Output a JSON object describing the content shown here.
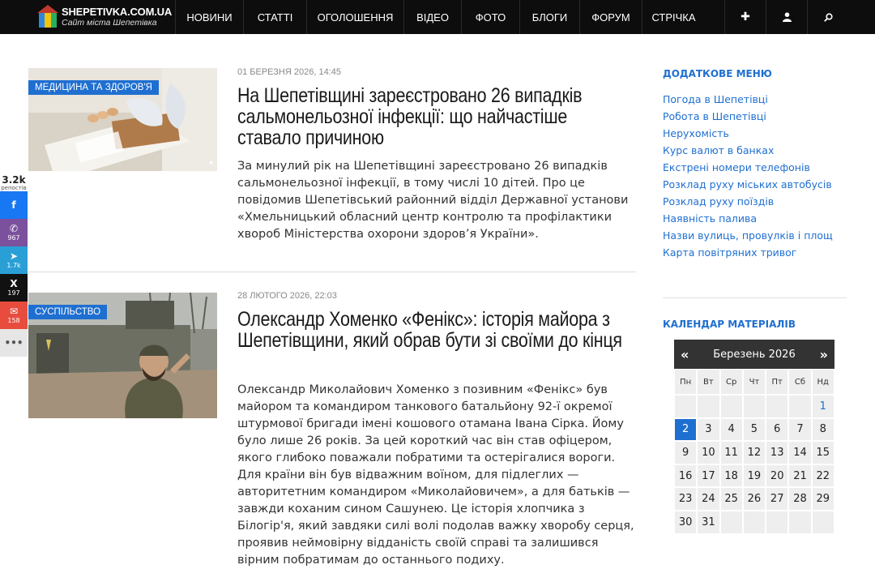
{
  "site": {
    "title": "SHEPETIVKA.COM.UA",
    "subtitle": "Сайт міста Шепетівка"
  },
  "nav": {
    "items": [
      "НОВИНИ",
      "СТАТТІ",
      "ОГОЛОШЕННЯ",
      "ВІДЕО",
      "ФОТО",
      "БЛОГИ",
      "ФОРУМ",
      "СТРІЧКА"
    ],
    "icons": [
      "plus-icon",
      "user-icon",
      "search-icon"
    ]
  },
  "share": {
    "total": "3.2k",
    "total_label": "репостів",
    "buttons": [
      {
        "name": "facebook",
        "icon": "f",
        "count": "",
        "color": "#1877f2"
      },
      {
        "name": "viber",
        "icon": "✆",
        "count": "967",
        "color": "#7b519d"
      },
      {
        "name": "telegram",
        "icon": "➤",
        "count": "1.7k",
        "color": "#2a9fd6"
      },
      {
        "name": "x",
        "icon": "X",
        "count": "197",
        "color": "#111111"
      },
      {
        "name": "email",
        "icon": "✉",
        "count": "158",
        "color": "#e74c3c"
      },
      {
        "name": "more",
        "icon": "•••",
        "count": "",
        "color": "#e6e6e6"
      }
    ]
  },
  "articles": [
    {
      "category": "МЕДИЦИНА ТА ЗДОРОВ'Я",
      "date": "01 БЕРЕЗНЯ 2026, 14:45",
      "title": "На Шепетівщині зареєстровано 26 випадків сальмонельозної інфекції: що найчастіше ставало причиною",
      "excerpt": "За минулий рік на Шепетівщині зареєстровано 26 випадків сальмонельозної інфекції, в тому числі 10 дітей. Про це повідомив Шепетівський районний відділ Державної установи «Хмельницький обласний центр контролю та профілактики хвороб Міністерства охорони здоров’я України»."
    },
    {
      "category": "СУСПІЛЬСТВО",
      "date": "28 ЛЮТОГО 2026, 22:03",
      "title": "Олександр Хоменко «Фенікс»: історія майора з Шепетівщини, який обрав бути зі своїми до кінця",
      "excerpt": "Олександр Миколайович Хоменко з позивним «Фенікс» був майором та командиром танкового батальйону 92-ї окремої штурмової бригади імені кошового отамана Івана Сірка. Йому було лише 26 років. За цей короткий час він став офіцером, якого глибоко поважали побратими та остерігалися вороги. Для країни він був відважним воїном, для підлеглих — авторитетним командиром «Миколайовичем», а для батьків — завжди коханим сином Сашунею. Це історія хлопчика з Білогір'я, який завдяки силі волі подолав важку хворобу серця, проявив неймовірну відданість своїй справі та залишився вірним побратимам до останнього подиху."
    }
  ],
  "sidebar": {
    "menu_title": "ДОДАТКОВЕ МЕНЮ",
    "links": [
      "Погода в Шепетівці",
      "Робота в Шепетівці",
      "Нерухомість",
      "Курс валют в банках",
      "Екстрені номери телефонів",
      "Розклад руху міських автобусів",
      "Розклад руху поїздів",
      "Наявність палива",
      "Назви вулиць, провулків і площ",
      "Карта повітряних тривог"
    ],
    "calendar_title": "КАЛЕНДАР МАТЕРІАЛІВ"
  },
  "calendar": {
    "prev": "«",
    "next": "»",
    "month": "Березень 2026",
    "dow": [
      "Пн",
      "Вт",
      "Ср",
      "Чт",
      "Пт",
      "Сб",
      "Нд"
    ],
    "weeks": [
      [
        "",
        "",
        "",
        "",
        "",
        "",
        "1"
      ],
      [
        "2",
        "3",
        "4",
        "5",
        "6",
        "7",
        "8"
      ],
      [
        "9",
        "10",
        "11",
        "12",
        "13",
        "14",
        "15"
      ],
      [
        "16",
        "17",
        "18",
        "19",
        "20",
        "21",
        "22"
      ],
      [
        "23",
        "24",
        "25",
        "26",
        "27",
        "28",
        "29"
      ],
      [
        "30",
        "31",
        "",
        "",
        "",
        "",
        ""
      ]
    ],
    "today": "2",
    "has_posts": [
      "1"
    ]
  }
}
